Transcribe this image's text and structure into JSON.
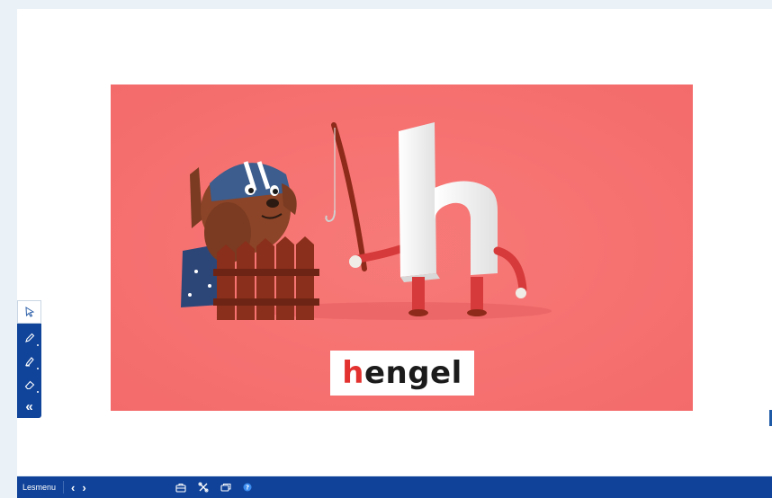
{
  "slide": {
    "word_first_letter": "h",
    "word_rest": "engel"
  },
  "colors": {
    "image_background": "#f57373",
    "word_highlight": "#e2312e",
    "toolbar": "#0f4298"
  },
  "tools": [
    "select-tool",
    "pen-tool",
    "highlighter-tool",
    "eraser-tool",
    "collapse-toolbar"
  ],
  "bottombar": {
    "menu_label": "Lesmenu",
    "prev": "‹",
    "next": "›",
    "icons": [
      "toolbox-icon",
      "tools-icon",
      "screens-icon",
      "help-icon"
    ]
  }
}
